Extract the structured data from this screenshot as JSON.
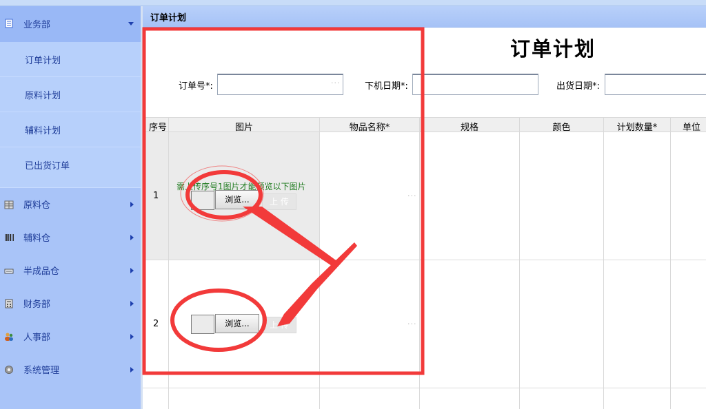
{
  "sidebar": {
    "sections": [
      {
        "label": "业务部",
        "icon": "document-icon",
        "expanded": true
      },
      {
        "label": "原料仓",
        "icon": "warehouse-icon"
      },
      {
        "label": "辅料仓",
        "icon": "barcode-icon"
      },
      {
        "label": "半成品仓",
        "icon": "tray-icon"
      },
      {
        "label": "财务部",
        "icon": "calculator-icon"
      },
      {
        "label": "人事部",
        "icon": "people-icon"
      },
      {
        "label": "系统管理",
        "icon": "gear-icon"
      }
    ],
    "sub_items": [
      {
        "label": "订单计划"
      },
      {
        "label": "原料计划"
      },
      {
        "label": "辅料计划"
      },
      {
        "label": "已出货订单"
      }
    ]
  },
  "header": {
    "title": "订单计划"
  },
  "form": {
    "title": "订单计划",
    "order_no_label": "订单号*:",
    "order_no_value": "",
    "order_date_label": "下机日期*:",
    "order_date_value": "",
    "ship_date_label": "出货日期*:",
    "ship_date_value": "",
    "picker_dots": "···"
  },
  "table": {
    "columns": [
      "序号",
      "图片",
      "物品名称*",
      "规格",
      "颜色",
      "计划数量*",
      "单位"
    ],
    "rows": [
      {
        "index": "1",
        "hint": "需上传序号1图片才能预览以下图片",
        "browse_label": "浏览...",
        "upload_label": "上 传",
        "dots": "···"
      },
      {
        "index": "2",
        "hint": "",
        "browse_label": "浏览...",
        "upload_label": "上 传",
        "dots": "···"
      }
    ]
  },
  "colors": {
    "sidebar_bg": "#a9c4f8",
    "sidebar_text": "#1f3d99",
    "annotation_red": "#f23a3a",
    "hint_green": "#1d7a1d"
  }
}
